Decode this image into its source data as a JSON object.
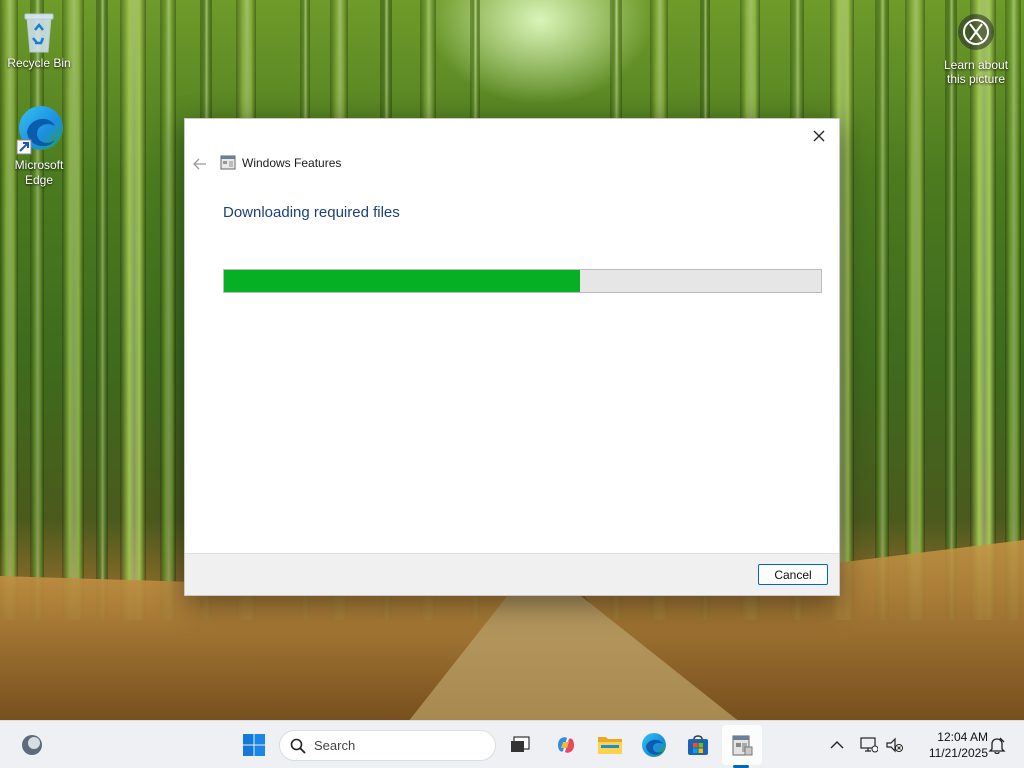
{
  "desktop": {
    "icons": [
      {
        "label": "Recycle Bin",
        "icon": "recycle-bin-icon"
      },
      {
        "label": "Microsoft Edge",
        "icon": "edge-icon"
      }
    ],
    "learn_label": "Learn about this picture",
    "learn_icon": "camera-info-icon"
  },
  "dialog": {
    "title": "Windows Features",
    "heading": "Downloading required files",
    "progress_fraction": 0.597,
    "cancel_label": "Cancel",
    "back_icon": "back-arrow-icon",
    "close_icon": "close-icon",
    "title_icon": "windows-features-icon"
  },
  "taskbar": {
    "search_placeholder": "Search",
    "apps": [
      "widgets-icon",
      "start-icon",
      "search-icon",
      "task-view-icon",
      "copilot-icon",
      "file-explorer-icon",
      "edge-icon",
      "store-icon",
      "windows-features-icon"
    ],
    "tray": {
      "time": "12:04 AM",
      "date": "11/21/2025",
      "icons": [
        "chevron-up-icon",
        "network-icon",
        "volume-muted-icon",
        "notification-icon"
      ]
    }
  },
  "colors": {
    "accent": "#0067c0",
    "progress": "#06b025",
    "heading": "#1e3f7a"
  }
}
